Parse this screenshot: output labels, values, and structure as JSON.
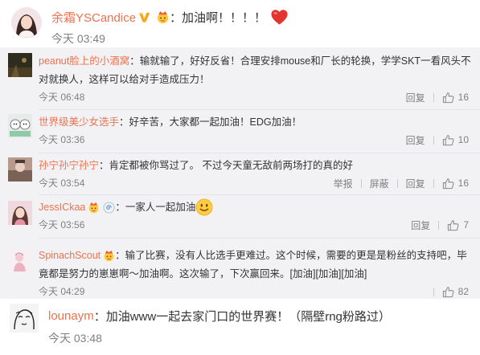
{
  "colors": {
    "username": "#eb7350",
    "text": "#333333",
    "meta": "#808080",
    "reply_bg": "#f2f2f5",
    "divider": "#e3e3e8",
    "verified": "#f7a71e",
    "heart": "#e3342f"
  },
  "main_comment": {
    "username": "余霜YSCandice",
    "verified_icon": "orange-verified-v-icon",
    "badge_icon": "fan-badge-icon",
    "text": "：加油啊！！！！",
    "emoji": "red-heart-icon",
    "time": "今天 03:49"
  },
  "replies": [
    {
      "username": "peanut脸上的小酒窝",
      "text_lines": [
        "：输就输了，好好反省！合理安排mouse和厂长的轮换，学学SKT一看风头不",
        "对就换人，这样可以给对手造成压力！"
      ],
      "time": "今天 06:48",
      "actions": [
        "回复"
      ],
      "like_icon": "thumb-up-icon",
      "likes": "16"
    },
    {
      "username": "世界级美少女选手",
      "text_lines": [
        "：好辛苦，大家都一起加油！EDG加油！"
      ],
      "time": "今天 03:36",
      "actions": [
        "回复"
      ],
      "like_icon": "thumb-up-icon",
      "likes": "10"
    },
    {
      "username": "孙宁孙宁孙宁",
      "text_lines": [
        "：肯定都被你骂过了。 不过今天童无敌前两场打的真的好"
      ],
      "time": "今天 03:54",
      "actions": [
        "举报",
        "屏蔽",
        "回复"
      ],
      "like_icon": "thumb-up-icon",
      "likes": "16"
    },
    {
      "username": "JessICkaa",
      "badges": [
        "fan-badge-icon",
        "swirl-badge-icon"
      ],
      "text_lines": [
        "：一家人一起加油"
      ],
      "emoji": "smiley-face-icon",
      "time": "今天 03:56",
      "actions": [
        "回复"
      ],
      "like_icon": "thumb-up-icon",
      "likes": "7"
    },
    {
      "username": "SpinachScout",
      "badges": [
        "fan-badge-icon"
      ],
      "text_lines": [
        "：输了比赛，没有人比选手更难过。这个时候，需要的更是是粉丝的支持吧，毕",
        "竟都是努力的崽崽啊～加油啊。这次输了，下次赢回来。[加油][加油][加油]"
      ],
      "time": "今天 04:29",
      "actions": [],
      "like_icon": "thumb-up-icon",
      "likes": "82"
    }
  ],
  "last_comment": {
    "username": "lounaym",
    "text": "：加油www一起去家门口的世界赛！（隔壁rng粉路过）",
    "time": "今天 03:48"
  }
}
